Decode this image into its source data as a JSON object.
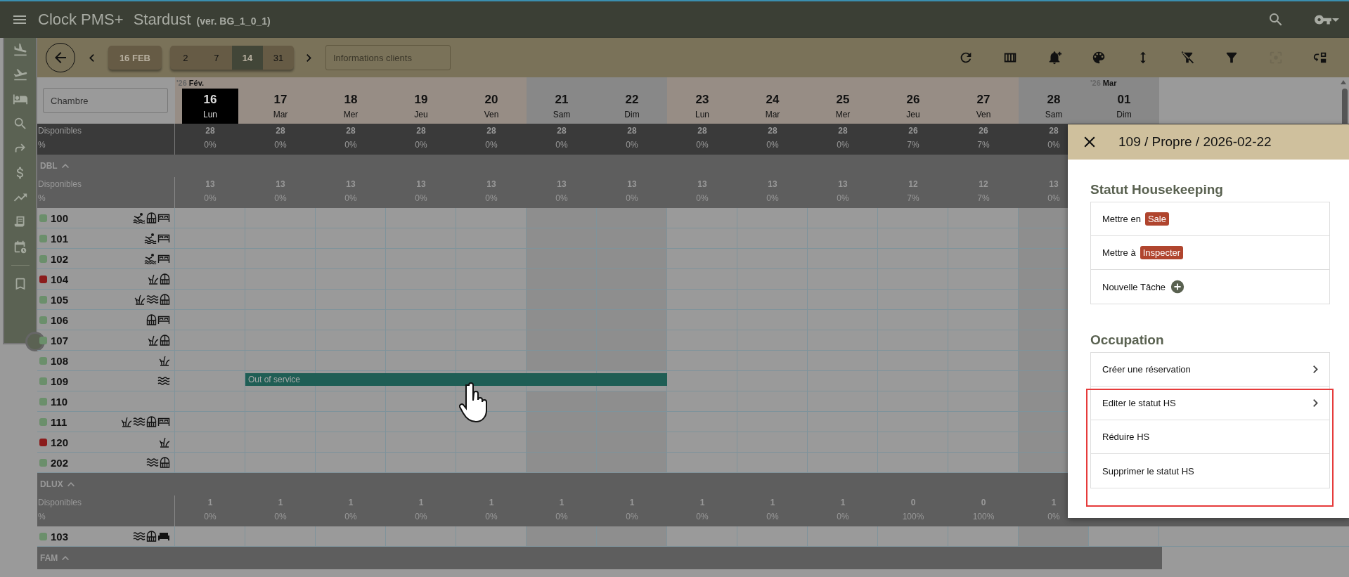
{
  "app_bar": {
    "title": "Clock PMS+",
    "property": "Stardust",
    "version": "(ver. BG_1_0_1)"
  },
  "nav_items": [
    {
      "kind": "arrivals"
    },
    {
      "kind": "departures"
    },
    {
      "kind": "rooms"
    },
    {
      "kind": "search"
    },
    {
      "kind": "forward"
    },
    {
      "kind": "billing"
    },
    {
      "kind": "reports"
    },
    {
      "kind": "invoices"
    },
    {
      "kind": "schedule"
    },
    {
      "kind": "bookmarks"
    }
  ],
  "toolbar": {
    "date_button": "16 FEB",
    "ranges": [
      {
        "label": "2",
        "selected": false
      },
      {
        "label": "7",
        "selected": false
      },
      {
        "label": "14",
        "selected": true
      },
      {
        "label": "31",
        "selected": false
      }
    ],
    "search_placeholder": "Informations clients",
    "tools": [
      {
        "kind": "refresh",
        "disabled": false
      },
      {
        "kind": "columns",
        "disabled": false
      },
      {
        "kind": "bell-plus",
        "disabled": false
      },
      {
        "kind": "palette",
        "disabled": false
      },
      {
        "kind": "height",
        "disabled": false
      },
      {
        "kind": "filter-off",
        "disabled": false
      },
      {
        "kind": "filter",
        "disabled": false
      },
      {
        "kind": "focus",
        "disabled": true
      },
      {
        "kind": "swap",
        "disabled": false
      }
    ]
  },
  "room_search_placeholder": "Chambre",
  "days": [
    {
      "year": "'26",
      "month": "Fév.",
      "day": "16",
      "weekday": "Lun",
      "weekend": false,
      "selected": true
    },
    {
      "day": "17",
      "weekday": "Mar",
      "weekend": false,
      "selected": false
    },
    {
      "day": "18",
      "weekday": "Mer",
      "weekend": false,
      "selected": false
    },
    {
      "day": "19",
      "weekday": "Jeu",
      "weekend": false,
      "selected": false
    },
    {
      "day": "20",
      "weekday": "Ven",
      "weekend": false,
      "selected": false
    },
    {
      "day": "21",
      "weekday": "Sam",
      "weekend": true,
      "selected": false
    },
    {
      "day": "22",
      "weekday": "Dim",
      "weekend": true,
      "selected": false
    },
    {
      "day": "23",
      "weekday": "Lun",
      "weekend": false,
      "selected": false
    },
    {
      "day": "24",
      "weekday": "Mar",
      "weekend": false,
      "selected": false
    },
    {
      "day": "25",
      "weekday": "Mer",
      "weekend": false,
      "selected": false
    },
    {
      "day": "26",
      "weekday": "Jeu",
      "weekend": false,
      "selected": false
    },
    {
      "day": "27",
      "weekday": "Ven",
      "weekend": false,
      "selected": false
    },
    {
      "day": "28",
      "weekday": "Sam",
      "weekend": true,
      "selected": false
    },
    {
      "year": "'26",
      "month": "Mar",
      "day": "01",
      "weekday": "Dim",
      "weekend": true,
      "selected": false
    }
  ],
  "totals": {
    "available_label": "Disponibles",
    "percent_label": "%",
    "available": [
      "28",
      "28",
      "28",
      "28",
      "28",
      "28",
      "28",
      "28",
      "28",
      "28",
      "26",
      "26",
      "28"
    ],
    "percent": [
      "0%",
      "0%",
      "0%",
      "0%",
      "0%",
      "0%",
      "0%",
      "0%",
      "0%",
      "0%",
      "7%",
      "7%",
      "0%"
    ]
  },
  "groups": [
    {
      "name": "DBL",
      "expanded": true,
      "available_label": "Disponibles",
      "percent_label": "%",
      "available": [
        "13",
        "13",
        "13",
        "13",
        "13",
        "13",
        "13",
        "13",
        "13",
        "13",
        "12",
        "12",
        "13"
      ],
      "percent": [
        "0%",
        "0%",
        "0%",
        "0%",
        "0%",
        "0%",
        "0%",
        "0%",
        "0%",
        "0%",
        "7%",
        "7%",
        "0%"
      ],
      "rooms": [
        {
          "number": "100",
          "color": "#6b8f6b",
          "features": [
            {
              "kind": "swimmer"
            },
            {
              "kind": "window"
            },
            {
              "kind": "bed"
            }
          ]
        },
        {
          "number": "101",
          "color": "#6b8f6b",
          "features": [
            {
              "kind": "swimmer"
            },
            {
              "kind": "bed"
            }
          ]
        },
        {
          "number": "102",
          "color": "#6b8f6b",
          "features": [
            {
              "kind": "swimmer"
            },
            {
              "kind": "bed"
            }
          ]
        },
        {
          "number": "104",
          "color": "#8b1c1c",
          "features": [
            {
              "kind": "grass"
            },
            {
              "kind": "window"
            }
          ]
        },
        {
          "number": "105",
          "color": "#6b8f6b",
          "features": [
            {
              "kind": "grass"
            },
            {
              "kind": "waves"
            },
            {
              "kind": "window"
            }
          ]
        },
        {
          "number": "106",
          "color": "#6b8f6b",
          "features": [
            {
              "kind": "window"
            },
            {
              "kind": "bed"
            }
          ]
        },
        {
          "number": "107",
          "color": "#6b8f6b",
          "features": [
            {
              "kind": "grass"
            },
            {
              "kind": "window"
            }
          ]
        },
        {
          "number": "108",
          "color": "#6b8f6b",
          "features": [
            {
              "kind": "grass"
            }
          ]
        },
        {
          "number": "109",
          "color": "#6b8f6b",
          "features": [
            {
              "kind": "waves"
            }
          ],
          "booking": {
            "label": "Out of service",
            "days": [
              false,
              true,
              true,
              true,
              true,
              true,
              true,
              false,
              false,
              false,
              false,
              false,
              false
            ]
          }
        },
        {
          "number": "110",
          "color": "#6b8f6b"
        },
        {
          "number": "111",
          "color": "#6b8f6b",
          "features": [
            {
              "kind": "grass"
            },
            {
              "kind": "waves"
            },
            {
              "kind": "window"
            },
            {
              "kind": "bed"
            }
          ]
        },
        {
          "number": "120",
          "color": "#8b1c1c",
          "features": [
            {
              "kind": "grass"
            }
          ]
        },
        {
          "number": "202",
          "color": "#6b8f6b",
          "features": [
            {
              "kind": "waves"
            },
            {
              "kind": "window"
            }
          ]
        }
      ]
    },
    {
      "name": "DLUX",
      "expanded": true,
      "available_label": "Disponibles",
      "percent_label": "%",
      "available": [
        "1",
        "1",
        "1",
        "1",
        "1",
        "1",
        "1",
        "1",
        "1",
        "1",
        "0",
        "0",
        "1"
      ],
      "percent": [
        "0%",
        "0%",
        "0%",
        "0%",
        "0%",
        "0%",
        "0%",
        "0%",
        "0%",
        "0%",
        "100%",
        "100%",
        "0%"
      ],
      "rooms": [
        {
          "number": "103",
          "color": "#6b8f6b",
          "features": [
            {
              "kind": "waves"
            },
            {
              "kind": "window"
            },
            {
              "kind": "sofa"
            }
          ]
        }
      ]
    },
    {
      "name": "FAM",
      "expanded": true
    }
  ],
  "panel": {
    "title": "109 / Propre / 2026-02-22",
    "sections": [
      {
        "heading": "Statut Housekeeping",
        "items": [
          {
            "kind": "badge",
            "label": "Mettre en",
            "badge": "Sale"
          },
          {
            "kind": "badge",
            "label": "Mettre à",
            "badge": "Inspecter"
          },
          {
            "kind": "add",
            "label": "Nouvelle Tâche"
          }
        ]
      },
      {
        "heading": "Occupation",
        "items": [
          {
            "kind": "link",
            "label": "Créer une réservation"
          },
          {
            "kind": "link",
            "label": "Editer le statut HS"
          },
          {
            "kind": "plain",
            "label": "Réduire HS"
          },
          {
            "kind": "plain",
            "label": "Supprimer le statut HS"
          }
        ]
      }
    ]
  }
}
